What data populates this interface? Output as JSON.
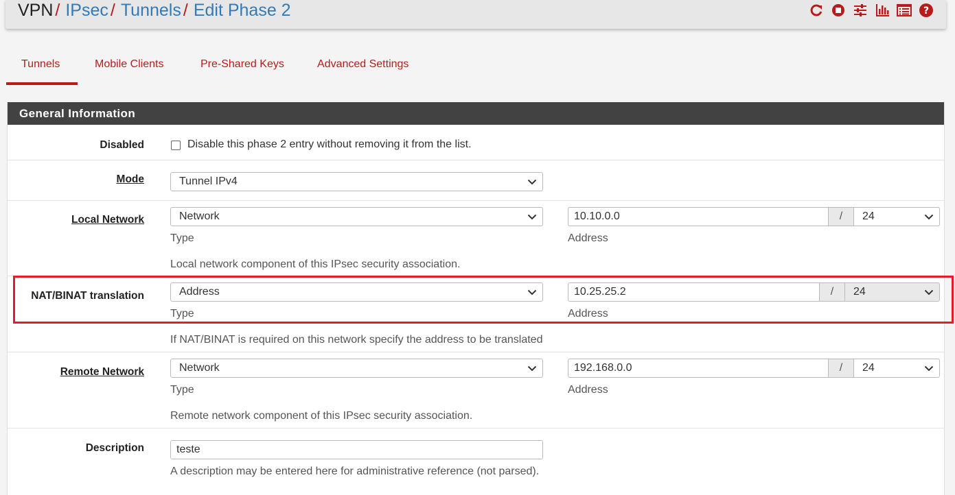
{
  "breadcrumb": {
    "items": [
      "VPN",
      "IPsec",
      "Tunnels",
      "Edit Phase 2"
    ],
    "separator": "/"
  },
  "header_icons": [
    "reload-icon",
    "stop-icon",
    "sliders-icon",
    "bar-chart-icon",
    "log-icon",
    "help-icon"
  ],
  "tabs": [
    {
      "label": "Tunnels",
      "active": true
    },
    {
      "label": "Mobile Clients",
      "active": false
    },
    {
      "label": "Pre-Shared Keys",
      "active": false
    },
    {
      "label": "Advanced Settings",
      "active": false
    }
  ],
  "panel": {
    "title": "General Information",
    "disabled": {
      "label": "Disabled",
      "checkbox_text": "Disable this phase 2 entry without removing it from the list.",
      "checked": false
    },
    "mode": {
      "label": "Mode",
      "value": "Tunnel IPv4"
    },
    "local_network": {
      "label": "Local Network",
      "type": "Network",
      "type_caption": "Type",
      "address": "10.10.0.0",
      "address_caption": "Address",
      "slash": "/",
      "mask": "24",
      "help": "Local network component of this IPsec security association."
    },
    "nat": {
      "label": "NAT/BINAT translation",
      "type": "Address",
      "type_caption": "Type",
      "address": "10.25.25.2",
      "address_caption": "Address",
      "slash": "/",
      "mask": "24",
      "help": "If NAT/BINAT is required on this network specify the address to be translated"
    },
    "remote_network": {
      "label": "Remote Network",
      "type": "Network",
      "type_caption": "Type",
      "address": "192.168.0.0",
      "address_caption": "Address",
      "slash": "/",
      "mask": "24",
      "help": "Remote network component of this IPsec security association."
    },
    "description": {
      "label": "Description",
      "value": "teste",
      "help": "A description may be entered here for administrative reference (not parsed)."
    }
  },
  "colors": {
    "accent": "#b71c1c",
    "link": "#337ab7",
    "panel_heading": "#424242",
    "highlight": "#e11d2b"
  }
}
